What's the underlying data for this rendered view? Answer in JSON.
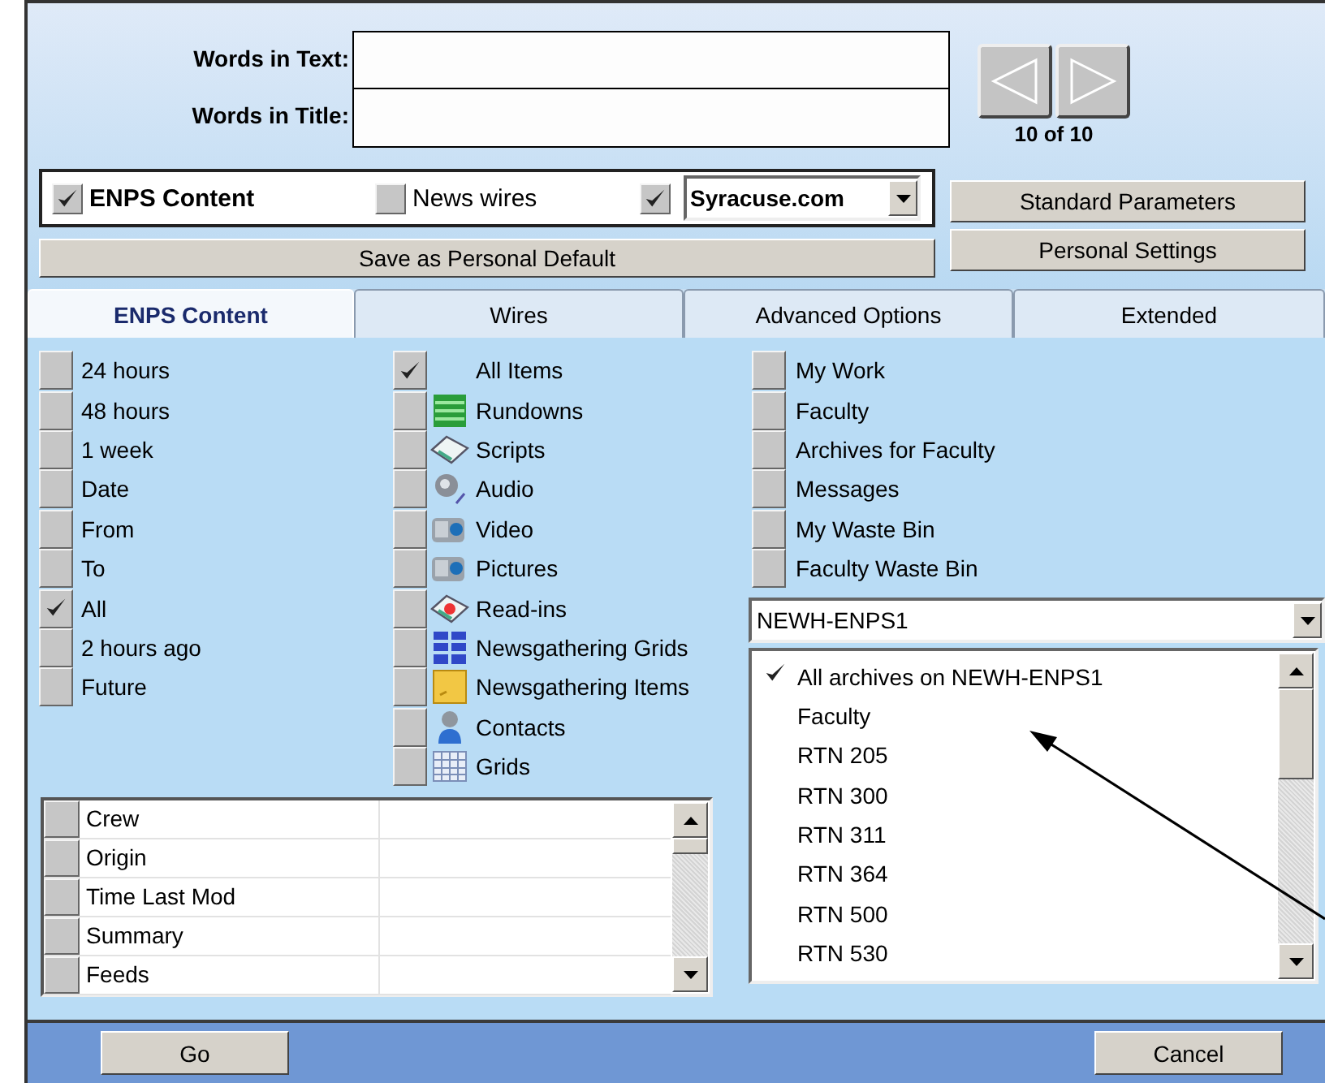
{
  "search": {
    "fields": [
      {
        "label": "Words in Text:"
      },
      {
        "label": "Words in Title:"
      }
    ]
  },
  "navigator": {
    "counter": "10 of 10"
  },
  "sources": {
    "enps": {
      "label": "ENPS Content",
      "checked": true
    },
    "wires": {
      "label": "News wires",
      "checked": false
    },
    "site": {
      "checked": true,
      "value": "Syracuse.com"
    }
  },
  "buttons": {
    "save_default": "Save as Personal Default",
    "standard": "Standard Parameters",
    "personal": "Personal Settings"
  },
  "tabs": [
    {
      "label": "ENPS Content",
      "selected": true
    },
    {
      "label": "Wires",
      "selected": false
    },
    {
      "label": "Advanced Options",
      "selected": false
    },
    {
      "label": "Extended",
      "selected": false
    }
  ],
  "time_filters": [
    {
      "label": "24 hours",
      "checked": false
    },
    {
      "label": "48 hours",
      "checked": false
    },
    {
      "label": "1 week",
      "checked": false
    },
    {
      "label": "Date",
      "checked": false
    },
    {
      "label": "From",
      "checked": false
    },
    {
      "label": "To",
      "checked": false
    },
    {
      "label": "All",
      "checked": true
    },
    {
      "label": "2 hours ago",
      "checked": false
    },
    {
      "label": "Future",
      "checked": false
    }
  ],
  "item_types": [
    {
      "label": "All Items",
      "checked": true
    },
    {
      "label": "Rundowns",
      "checked": false
    },
    {
      "label": "Scripts",
      "checked": false
    },
    {
      "label": "Audio",
      "checked": false
    },
    {
      "label": "Video",
      "checked": false
    },
    {
      "label": "Pictures",
      "checked": false
    },
    {
      "label": "Read-ins",
      "checked": false
    },
    {
      "label": "Newsgathering Grids",
      "checked": false
    },
    {
      "label": "Newsgathering Items",
      "checked": false
    },
    {
      "label": "Contacts",
      "checked": false
    },
    {
      "label": "Grids",
      "checked": false
    }
  ],
  "locations": [
    {
      "label": "My Work",
      "checked": false
    },
    {
      "label": "Faculty",
      "checked": false
    },
    {
      "label": "Archives for Faculty",
      "checked": false
    },
    {
      "label": "Messages",
      "checked": false
    },
    {
      "label": "My Waste Bin",
      "checked": false
    },
    {
      "label": "Faculty Waste Bin",
      "checked": false
    }
  ],
  "server": {
    "value": "NEWH-ENPS1"
  },
  "archives": [
    {
      "label": "All archives on NEWH-ENPS1",
      "checked": true
    },
    {
      "label": "Faculty",
      "checked": false
    },
    {
      "label": "RTN 205",
      "checked": false
    },
    {
      "label": "RTN 300",
      "checked": false
    },
    {
      "label": "RTN 311",
      "checked": false
    },
    {
      "label": "RTN 364",
      "checked": false
    },
    {
      "label": "RTN 500",
      "checked": false
    },
    {
      "label": "RTN 530",
      "checked": false
    }
  ],
  "field_rows": [
    {
      "label": "Crew",
      "checked": false
    },
    {
      "label": "Origin",
      "checked": false
    },
    {
      "label": "Time Last Mod",
      "checked": false
    },
    {
      "label": "Summary",
      "checked": false
    },
    {
      "label": "Feeds",
      "checked": false
    }
  ],
  "footer": {
    "go": "Go",
    "cancel": "Cancel"
  }
}
